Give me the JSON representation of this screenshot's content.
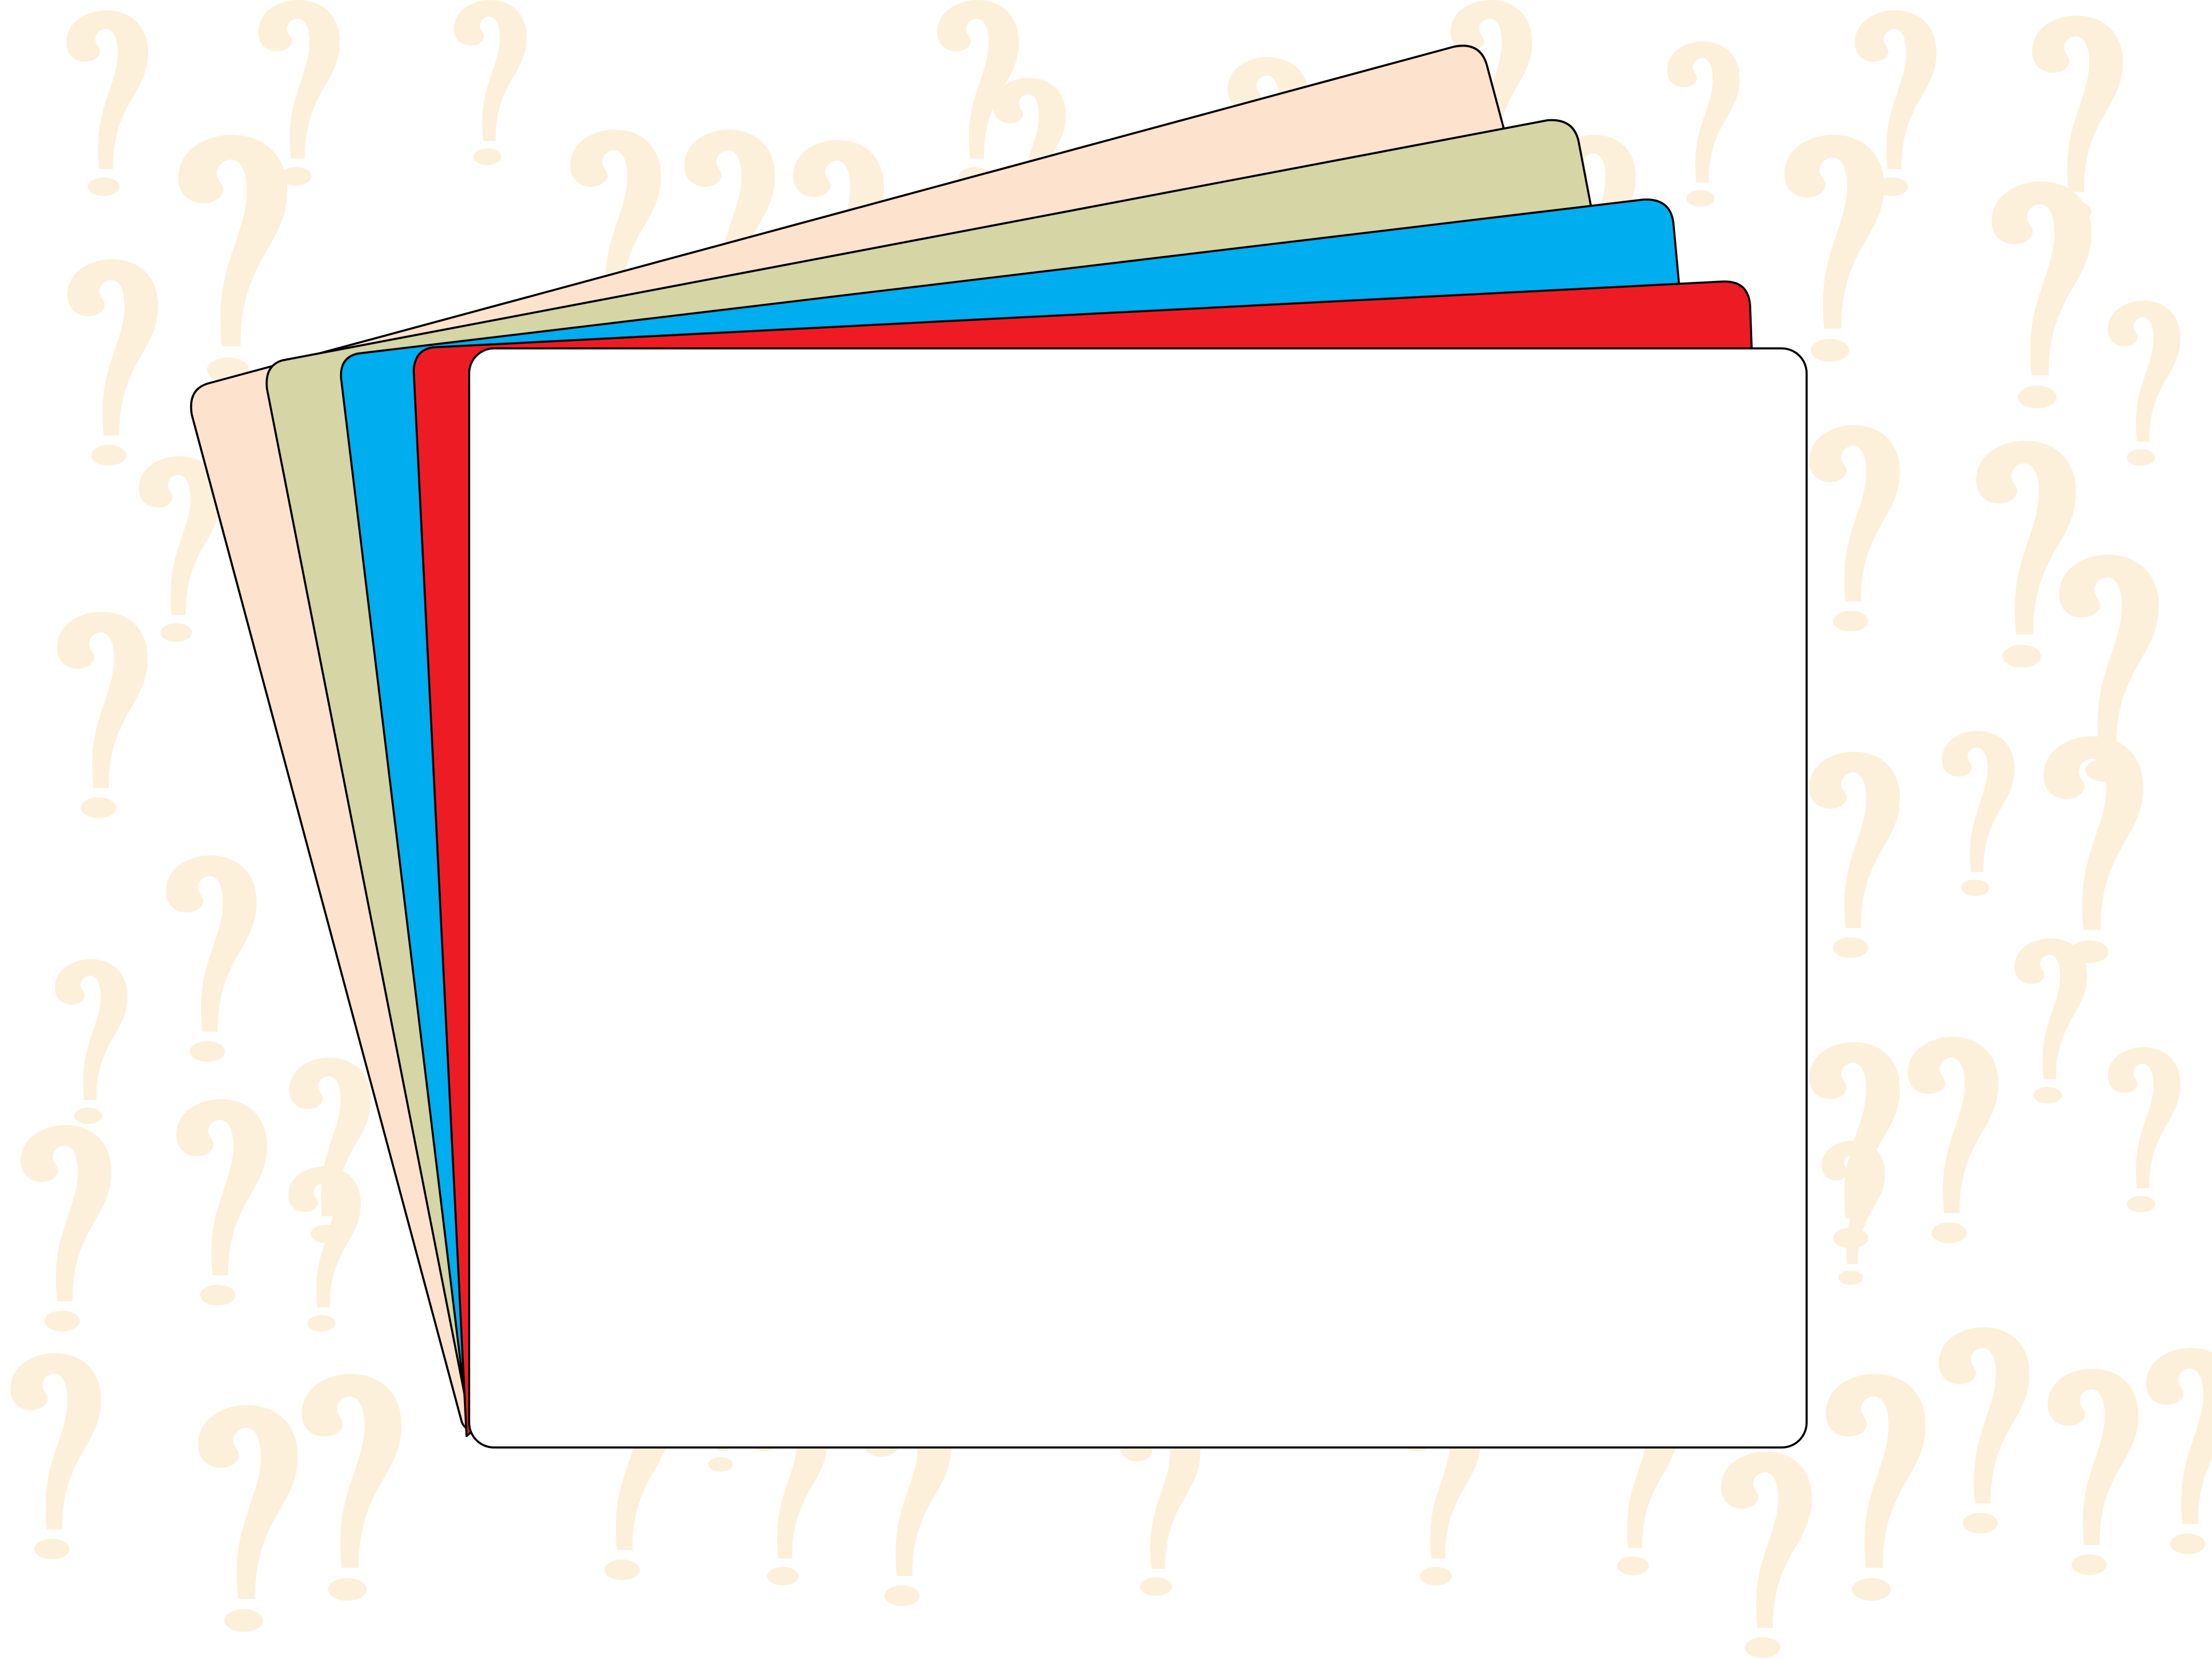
{
  "palette": {
    "background": "#ffffff",
    "question_mark": "#fdf0db",
    "outline": "#000000"
  },
  "background_pattern": {
    "icon": "question-mark-icon"
  },
  "cards": [
    {
      "name": "card-peach",
      "color": "#fde3cd"
    },
    {
      "name": "card-sage",
      "color": "#d6d5a6"
    },
    {
      "name": "card-blue",
      "color": "#00adef"
    },
    {
      "name": "card-red",
      "color": "#ed1c24"
    },
    {
      "name": "card-front-white",
      "color": "#ffffff"
    }
  ]
}
